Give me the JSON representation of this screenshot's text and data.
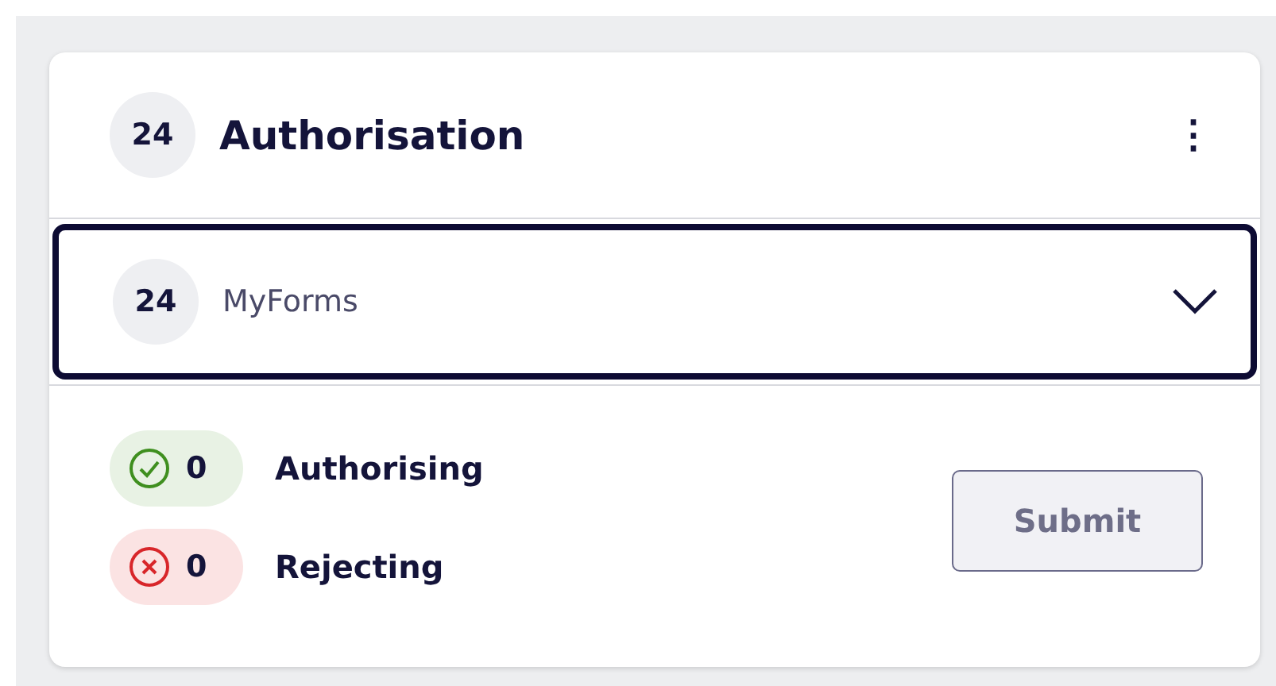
{
  "header": {
    "count": "24",
    "title": "Authorisation",
    "menu_icon": "⋮"
  },
  "dropdown": {
    "count": "24",
    "label": "MyForms",
    "expanded": false
  },
  "tallies": [
    {
      "kind": "authorise",
      "count": "0",
      "label": "Authorising"
    },
    {
      "kind": "reject",
      "count": "0",
      "label": "Rejecting"
    }
  ],
  "submit": {
    "label": "Submit",
    "disabled": true
  }
}
